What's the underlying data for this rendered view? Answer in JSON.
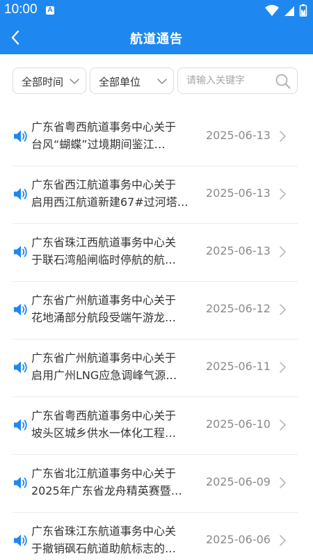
{
  "status_bar": {
    "time": "10:00",
    "notification_glyph": "A",
    "icons": [
      "wifi-icon",
      "signal-icon",
      "battery-icon"
    ]
  },
  "header": {
    "title": "航道通告",
    "back_icon": "chevron-left-icon"
  },
  "filters": {
    "time": {
      "label": "全部时间"
    },
    "unit": {
      "label": "全部单位"
    },
    "search": {
      "placeholder": "请输入关键字",
      "value": ""
    }
  },
  "notices": [
    {
      "line1": "广东省粤西航道事务中心关于",
      "line2": "台风“蝴蝶”过境期间鉴江…",
      "date": "2025-06-13"
    },
    {
      "line1": "广东省西江航道事务中心关于",
      "line2": "启用西江航道新建67#过河塔…",
      "date": "2025-06-13"
    },
    {
      "line1": "广东省珠江西航道事务中心关",
      "line2": "于联石湾船闸临时停航的航…",
      "date": "2025-06-13"
    },
    {
      "line1": "广东省广州航道事务中心关于",
      "line2": "花地涌部分航段受端午游龙…",
      "date": "2025-06-12"
    },
    {
      "line1": "广东省广州航道事务中心关于",
      "line2": "启用广州LNG应急调峰气源…",
      "date": "2025-06-11"
    },
    {
      "line1": "广东省粤西航道事务中心关于",
      "line2": "坡头区城乡供水一体化工程…",
      "date": "2025-06-10"
    },
    {
      "line1": "广东省北江航道事务中心关于",
      "line2": "2025年广东省龙舟精英赛暨…",
      "date": "2025-06-09"
    },
    {
      "line1": "广东省珠江东航道事务中心关",
      "line2": "于撤销砜石航道助航标志的…",
      "date": "2025-06-06"
    }
  ],
  "colors": {
    "brand_blue": "#1e88f0",
    "text": "#333333",
    "date": "#8a8a8a",
    "divider": "#ececec"
  }
}
